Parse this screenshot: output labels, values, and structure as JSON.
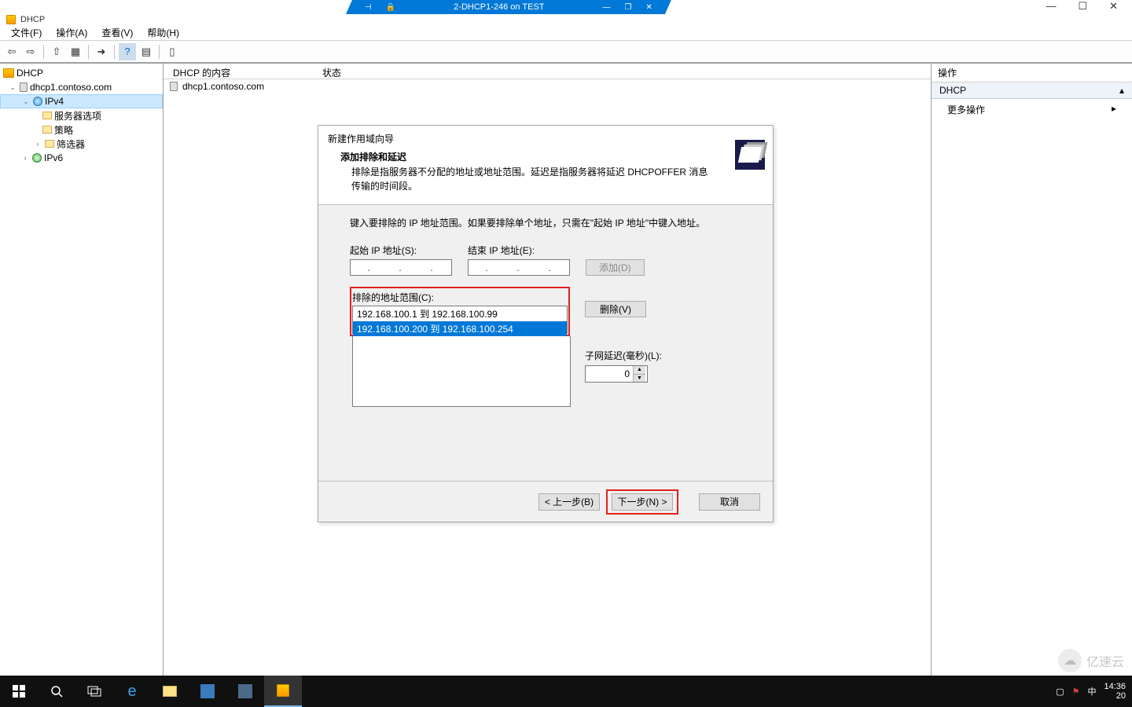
{
  "vm": {
    "title": "2-DHCP1-246 on TEST",
    "pin_icon": "⊣",
    "lock_icon": "🔒",
    "min": "—",
    "restore": "❐",
    "close": "✕"
  },
  "outer_window": {
    "min": "—",
    "max": "☐",
    "close": "✕"
  },
  "mmc": {
    "title": "DHCP"
  },
  "menu": {
    "file": "文件(F)",
    "action": "操作(A)",
    "view": "查看(V)",
    "help": "帮助(H)"
  },
  "toolbar": {
    "back": "⇦",
    "forward": "⇨",
    "up": "⇧",
    "show": "▦",
    "export": "➜",
    "refresh": "🗘",
    "props": "?",
    "help": "▤",
    "extra": "▯"
  },
  "tree": {
    "root": "DHCP",
    "server": "dhcp1.contoso.com",
    "ipv4": "IPv4",
    "server_options": "服务器选项",
    "policies": "策略",
    "filters": "筛选器",
    "ipv6": "IPv6"
  },
  "content": {
    "col_name": "DHCP 的内容",
    "col_state": "状态",
    "row_server": "dhcp1.contoso.com"
  },
  "actions": {
    "header": "操作",
    "section": "DHCP",
    "more": "更多操作",
    "arrow": "▴",
    "sub": "▸"
  },
  "wizard": {
    "title": "新建作用域向导",
    "subtitle": "添加排除和延迟",
    "description": "排除是指服务器不分配的地址或地址范围。延迟是指服务器将延迟 DHCPOFFER 消息传输的时间段。",
    "instruction": "键入要排除的 IP 地址范围。如果要排除单个地址，只需在\"起始 IP 地址\"中键入地址。",
    "start_ip_label": "起始 IP 地址(S):",
    "end_ip_label": "结束 IP 地址(E):",
    "add_btn": "添加(D)",
    "excluded_label": "排除的地址范围(C):",
    "exclusions": [
      "192.168.100.1 到 192.168.100.99",
      "192.168.100.200 到 192.168.100.254"
    ],
    "delete_btn": "删除(V)",
    "delay_label": "子网延迟(毫秒)(L):",
    "delay_value": "0",
    "back_btn": "< 上一步(B)",
    "next_btn": "下一步(N) >",
    "cancel_btn": "取消"
  },
  "taskbar": {
    "time": "14:36",
    "date_partial": "20",
    "ime": "中",
    "tray1": "▢",
    "tray2": "⚑"
  },
  "watermark": {
    "text": "亿速云",
    "icon": "☁"
  }
}
